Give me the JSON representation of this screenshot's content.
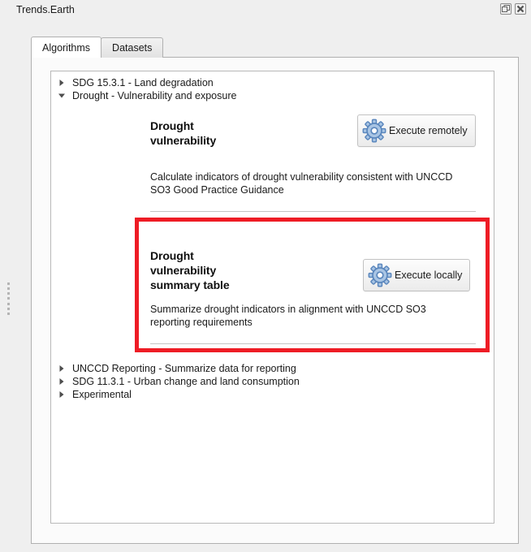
{
  "window": {
    "title": "Trends.Earth",
    "controls": [
      {
        "name": "float-icon",
        "label": "Float"
      },
      {
        "name": "close-icon",
        "label": "Close"
      }
    ]
  },
  "tabs": [
    {
      "label": "Algorithms",
      "active": true
    },
    {
      "label": "Datasets",
      "active": false
    }
  ],
  "tree": {
    "top_items": [
      {
        "label": "SDG 15.3.1 - Land degradation",
        "expanded": false
      },
      {
        "label": "Drought - Vulnerability and exposure",
        "expanded": true
      }
    ],
    "bottom_items": [
      {
        "label": "UNCCD Reporting - Summarize data for reporting",
        "expanded": false
      },
      {
        "label": "SDG 11.3.1 - Urban change and land consumption",
        "expanded": false
      },
      {
        "label": "Experimental",
        "expanded": false
      }
    ]
  },
  "algorithms": [
    {
      "title": "Drought\nvulnerability",
      "title_line1": "Drought",
      "title_line2": "vulnerability",
      "title_line3": "",
      "description": "Calculate indicators of drought vulnerability consistent with UNCCD SO3 Good Practice Guidance",
      "button_label": "Execute remotely",
      "button_icon": "gear-icon",
      "highlighted": false
    },
    {
      "title": "Drought\nvulnerability\nsummary table",
      "title_line1": "Drought",
      "title_line2": "vulnerability",
      "title_line3": "summary table",
      "description": "Summarize drought indicators in alignment with UNCCD SO3 reporting requirements",
      "button_label": "Execute locally",
      "button_icon": "gear-icon",
      "highlighted": true
    }
  ],
  "colors": {
    "highlight": "#ee1c25",
    "gear_fill": "#a9c5e4",
    "gear_stroke": "#5b87bd",
    "panel_bg": "#fbfbfb",
    "window_bg": "#efefef",
    "text": "#1a1a1a"
  }
}
